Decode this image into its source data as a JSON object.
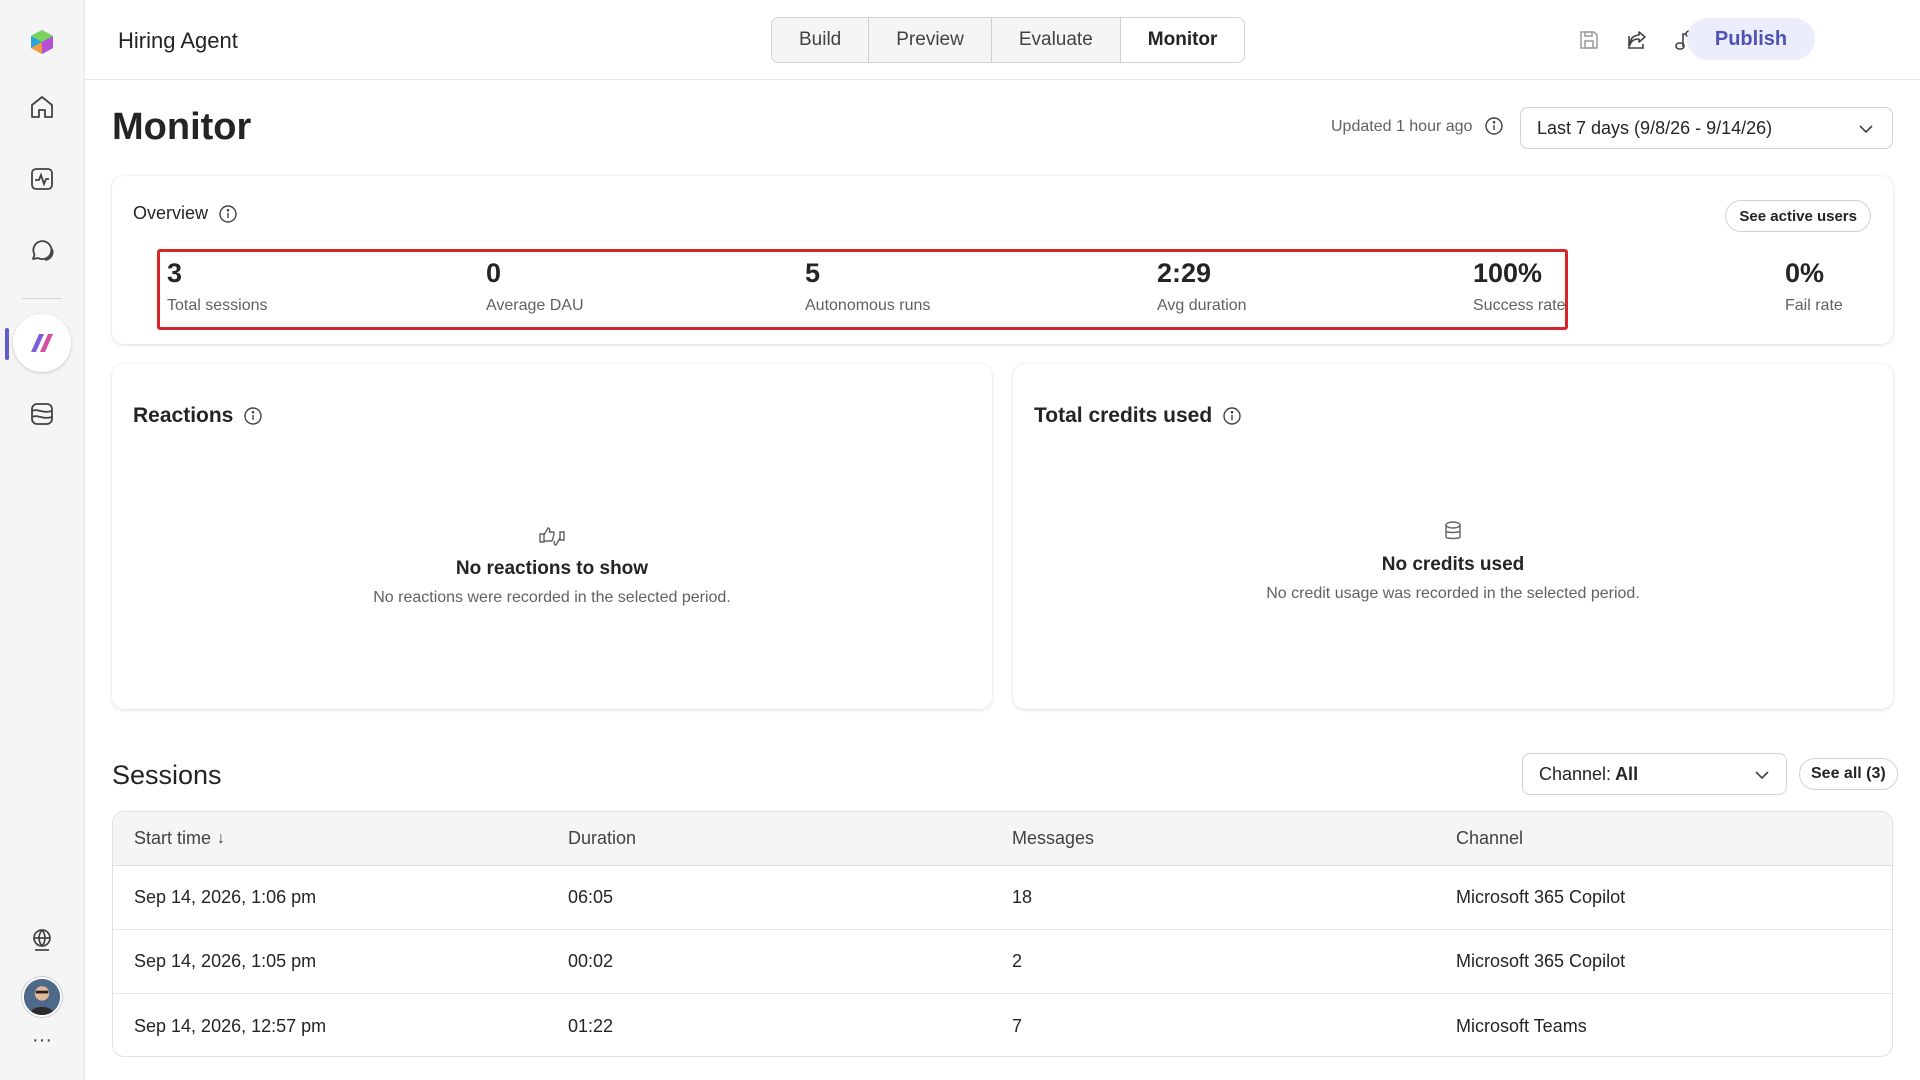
{
  "app": {
    "agent_name": "Hiring Agent",
    "tabs": [
      {
        "label": "Build",
        "active": false
      },
      {
        "label": "Preview",
        "active": false
      },
      {
        "label": "Evaluate",
        "active": false
      },
      {
        "label": "Monitor",
        "active": true
      }
    ],
    "publish_label": "Publish",
    "toolbar_icons": [
      "save-icon",
      "share-icon",
      "connect-icon",
      "more-icon"
    ]
  },
  "rail": {
    "items": [
      "copilot-logo-icon",
      "home-icon",
      "activity-icon",
      "chat-icon",
      "agent-studio-icon",
      "library-icon"
    ],
    "bottom": [
      "globe-icon",
      "avatar",
      "more-icon"
    ],
    "more_label": "···"
  },
  "monitor": {
    "title": "Monitor",
    "updated": "Updated 1 hour ago",
    "date_range": "Last 7 days (9/8/26 - 9/14/26)"
  },
  "overview": {
    "title": "Overview",
    "see_active_users": "See active users",
    "metrics": [
      {
        "value": "3",
        "label": "Total sessions"
      },
      {
        "value": "0",
        "label": "Average DAU"
      },
      {
        "value": "5",
        "label": "Autonomous runs"
      },
      {
        "value": "2:29",
        "label": "Avg duration"
      },
      {
        "value": "100%",
        "label": "Success rate"
      },
      {
        "value": "0%",
        "label": "Fail rate"
      }
    ]
  },
  "reactions": {
    "title": "Reactions",
    "empty_title": "No reactions to show",
    "empty_subtitle": "No reactions were recorded in the selected period."
  },
  "credits": {
    "title": "Total credits used",
    "empty_title": "No credits used",
    "empty_subtitle": "No credit usage was recorded in the selected period."
  },
  "sessions": {
    "title": "Sessions",
    "channel_prefix": "Channel:",
    "channel_value": "All",
    "see_all": "See all (3)",
    "columns": [
      "Start time",
      "Duration",
      "Messages",
      "Channel"
    ],
    "sort_indicator": "↓",
    "rows": [
      {
        "start": "Sep 14, 2026, 1:06 pm",
        "duration": "06:05",
        "messages": "18",
        "channel": "Microsoft 365 Copilot"
      },
      {
        "start": "Sep 14, 2026, 1:05 pm",
        "duration": "00:02",
        "messages": "2",
        "channel": "Microsoft 365 Copilot"
      },
      {
        "start": "Sep 14, 2026, 12:57 pm",
        "duration": "01:22",
        "messages": "7",
        "channel": "Microsoft Teams"
      }
    ]
  },
  "colors": {
    "accent": "#5b5fc7",
    "publish_bg": "#ebedfc",
    "publish_text": "#4f52b2",
    "highlight": "#d9242b"
  }
}
